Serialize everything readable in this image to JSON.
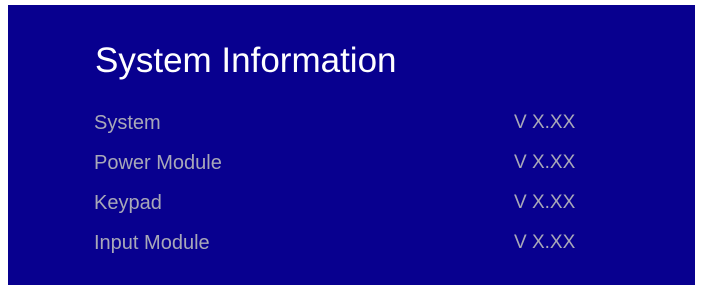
{
  "title": "System Information",
  "rows": [
    {
      "label": "System",
      "value": "V X.XX"
    },
    {
      "label": "Power Module",
      "value": "V X.XX"
    },
    {
      "label": "Keypad",
      "value": "V X.XX"
    },
    {
      "label": "Input Module",
      "value": "V X.XX"
    }
  ],
  "colors": {
    "background": "#08008F",
    "title": "#FFFFFF",
    "text": "#A8A8B8"
  }
}
